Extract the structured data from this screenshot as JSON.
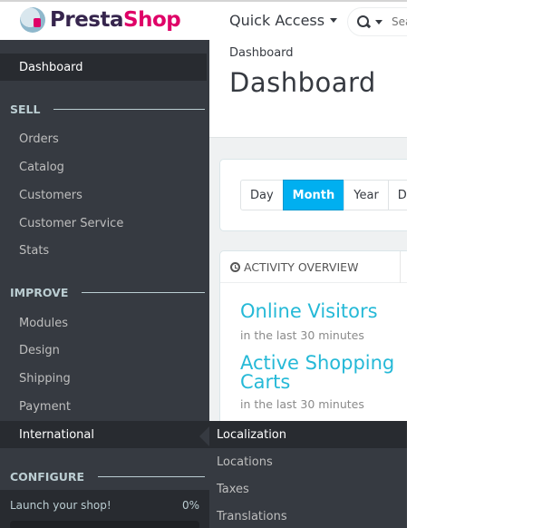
{
  "header": {
    "brand_part1": "Presta",
    "brand_part2": "Shop",
    "quick_access_label": "Quick Access",
    "search_placeholder": "Search"
  },
  "sidebar": {
    "dashboard": "Dashboard",
    "sections": [
      {
        "title": "SELL",
        "items": [
          "Orders",
          "Catalog",
          "Customers",
          "Customer Service",
          "Stats"
        ]
      },
      {
        "title": "IMPROVE",
        "items": [
          "Modules",
          "Design",
          "Shipping",
          "Payment",
          "International"
        ]
      },
      {
        "title": "CONFIGURE",
        "items": []
      }
    ],
    "active_item": "International",
    "launch": {
      "label": "Launch your shop!",
      "percent": "0%",
      "progress": 0
    }
  },
  "submenu": {
    "items": [
      "Localization",
      "Locations",
      "Taxes",
      "Translations"
    ],
    "active": "Localization"
  },
  "main": {
    "breadcrumb": "Dashboard",
    "title": "Dashboard",
    "period_buttons": [
      "Day",
      "Month",
      "Year",
      "Day"
    ],
    "active_period": "Month",
    "activity": {
      "header": "ACTIVITY OVERVIEW",
      "metrics": [
        {
          "title": "Online Visitors",
          "subtitle": "in the last 30 minutes"
        },
        {
          "title": "Active Shopping Carts",
          "subtitle": "in the last 30 minutes"
        }
      ]
    }
  },
  "colors": {
    "accent": "#00aff0",
    "metric_title": "#25b9d7",
    "sidebar_bg": "#363a41",
    "sidebar_active_bg": "#282b30",
    "brand_dark": "#36254d",
    "brand_pink": "#df0067"
  }
}
